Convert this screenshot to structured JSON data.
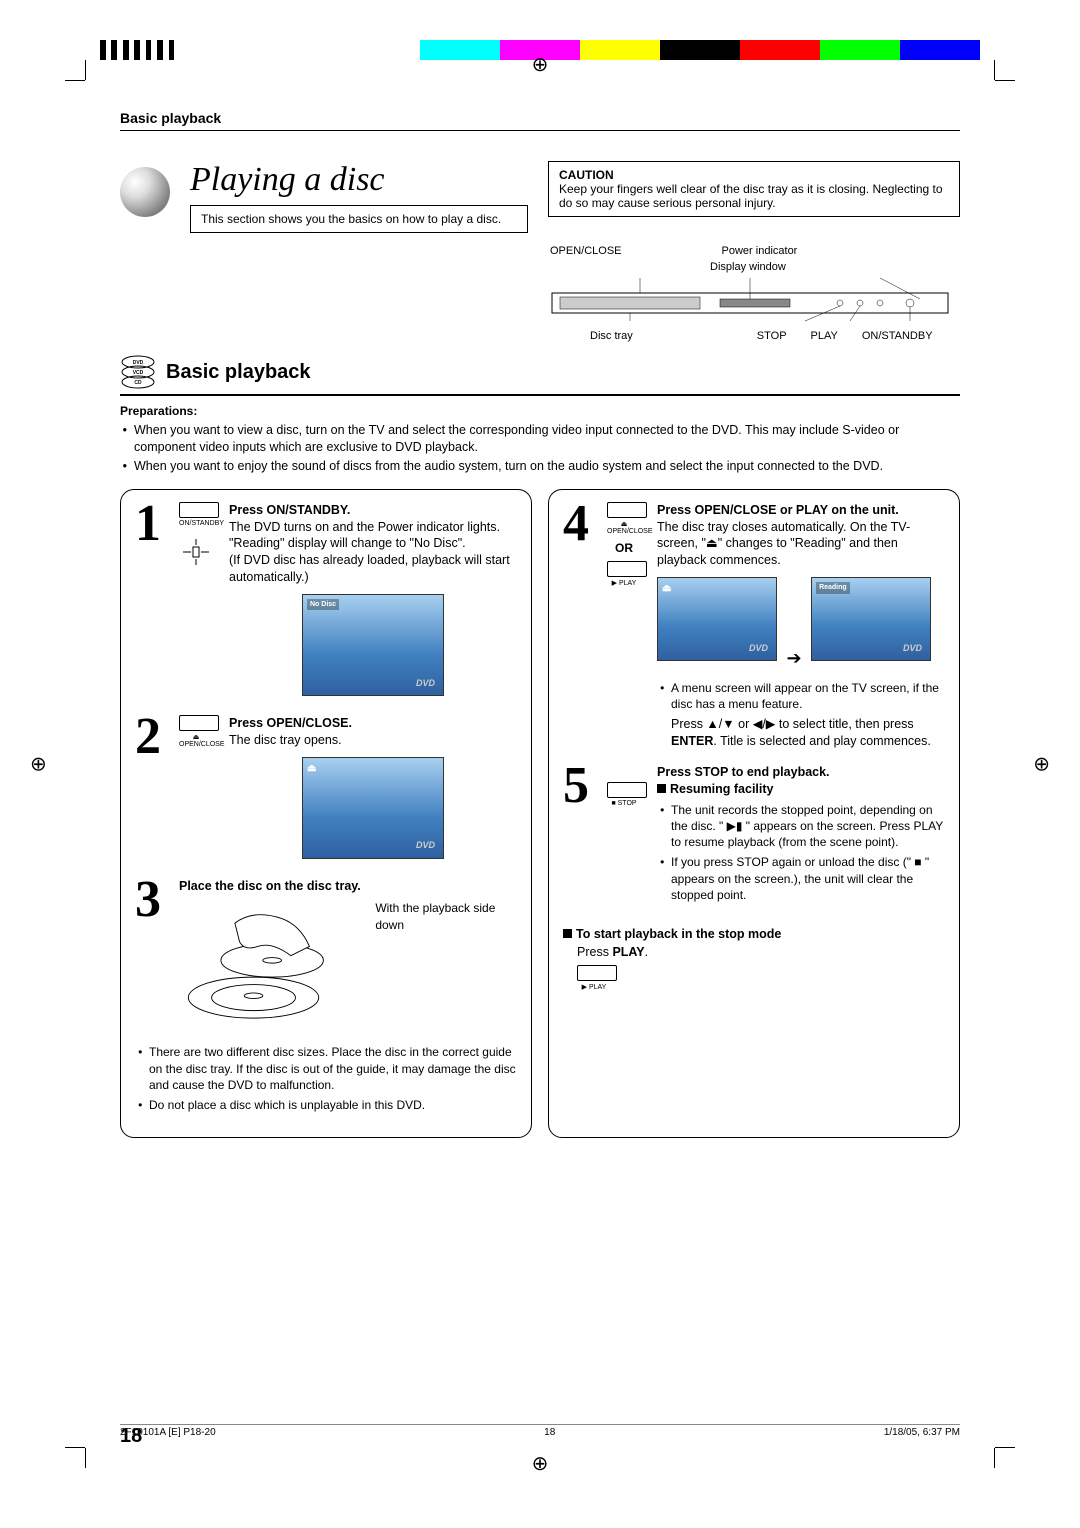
{
  "header": {
    "section_label": "Basic playback"
  },
  "title": "Playing a disc",
  "subtitle": "This section shows you the basics on how to play a disc.",
  "caution": {
    "heading": "CAUTION",
    "text": "Keep your fingers well clear of the disc tray as it is closing. Neglecting to do so may cause serious personal injury."
  },
  "diagram": {
    "top_labels": [
      "OPEN/CLOSE",
      "Power indicator",
      "Display window"
    ],
    "bottom_labels": [
      "Disc tray",
      "STOP",
      "PLAY",
      "ON/STANDBY"
    ]
  },
  "disc_types": [
    "DVD",
    "VCD",
    "CD"
  ],
  "section_title": "Basic playback",
  "preparations_heading": "Preparations:",
  "preparations": [
    "When you want to view a disc, turn on the TV and select the corresponding video input connected to the DVD. This may include S-video or component video inputs which are exclusive to DVD playback.",
    "When you want to enjoy the sound of discs from the audio system, turn on the audio system and select the input connected to the DVD."
  ],
  "steps_left": [
    {
      "num": "1",
      "title": "Press ON/STANDBY.",
      "button_label": "ON/STANDBY",
      "body1": "The DVD turns on and the Power indicator lights.",
      "body2": "\"Reading\" display will change to \"No Disc\".",
      "body3": "(If DVD disc has already loaded, playback will start automatically.)",
      "osd": "No Disc"
    },
    {
      "num": "2",
      "title": "Press OPEN/CLOSE.",
      "button_label": "OPEN/CLOSE",
      "body1": "The disc tray opens."
    },
    {
      "num": "3",
      "title": "Place the disc on the disc tray.",
      "body1": "With the playback side down"
    }
  ],
  "left_notes": [
    "There are two different disc sizes. Place the disc in the correct guide on the disc tray. If the disc is out of the guide, it may damage the disc and cause the DVD to malfunction.",
    "Do not place a disc which is unplayable in this DVD."
  ],
  "steps_right": [
    {
      "num": "4",
      "title": "Press OPEN/CLOSE or PLAY on the unit.",
      "button_label1": "OPEN/CLOSE",
      "or": "OR",
      "button_label2": "PLAY",
      "body1": "The disc tray closes automatically. On the TV-screen, \"⏏\" changes to \"Reading\" and then playback commences.",
      "osd2": "Reading",
      "note1": "A menu screen will appear on the TV screen, if the disc has a menu feature.",
      "note2_a": "Press ▲/▼ or ◀/▶ to select title, then press ",
      "note2_b": "ENTER",
      "note2_c": ". Title is selected and play commences."
    },
    {
      "num": "5",
      "title": "Press STOP to end playback.",
      "button_label": "STOP",
      "sub_heading": "Resuming facility",
      "bullets": [
        "The unit records the stopped point, depending on the disc. \" ▶▮ \" appears on the screen. Press PLAY to resume playback (from the scene point).",
        "If you press STOP again or unload the disc (\" ■ \" appears on the screen.), the unit will clear the stopped point."
      ]
    }
  ],
  "start_playback": {
    "heading": "To start playback in the stop mode",
    "body_a": "Press ",
    "body_b": "PLAY",
    "body_c": ".",
    "button_label": "PLAY"
  },
  "page_number": "18",
  "footer": {
    "left": "2F10101A [E] P18-20",
    "center": "18",
    "right": "1/18/05, 6:37 PM"
  }
}
